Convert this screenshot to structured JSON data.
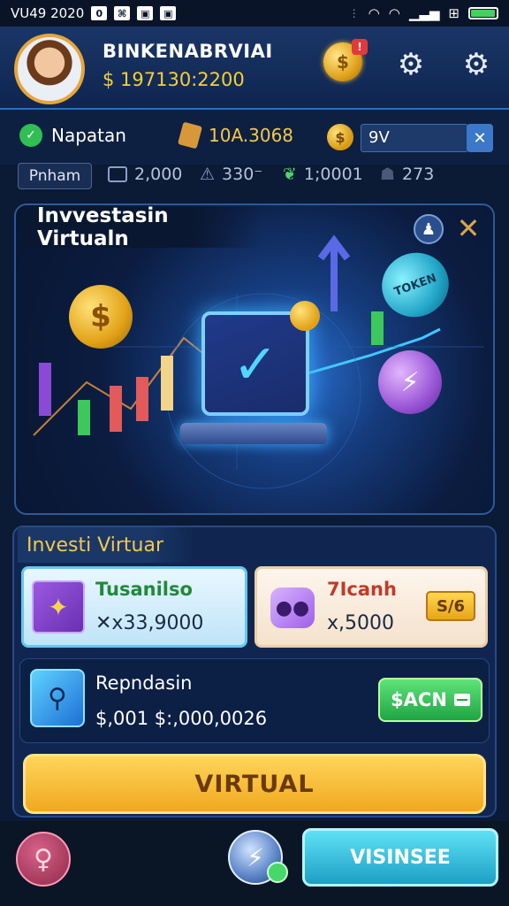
{
  "status_bar": {
    "time": "VU49 2020",
    "icons_left": [
      "0",
      "⌘",
      "▣",
      "▣"
    ]
  },
  "header": {
    "username": "BINKENABRVIAI",
    "balance": "$ 197130:2200",
    "notif_badge": "!"
  },
  "resources": {
    "item1_label": "Napatan",
    "item2_value": "10A.3068",
    "field_value": "9V",
    "close_label": "✕"
  },
  "stats": {
    "pill_label": "Pnham",
    "stat1": "2,000",
    "stat2": "330⁻",
    "stat3": "1;0001",
    "stat4": "273"
  },
  "banner": {
    "title": "Invvestasin Virtualn",
    "token_text": "TOKEN"
  },
  "invest_panel": {
    "title": "Investi Virtuar",
    "card1": {
      "name": "Tusanilso",
      "value": "✕x33,9000"
    },
    "card2": {
      "name": "7Icanh",
      "value": "x,5000",
      "badge": "S/6"
    },
    "card3": {
      "name": "Repndasin",
      "value": "$,001 $:,000,0026",
      "button": "$ACN"
    }
  },
  "main_button": "VIRTUAL",
  "bottom_nav": {
    "right_button": "VISINSEE"
  },
  "colors": {
    "accent_gold": "#f5cf3a",
    "primary_bg": "#0b1a35",
    "green": "#1fa543",
    "cyan": "#1c9fc4"
  }
}
